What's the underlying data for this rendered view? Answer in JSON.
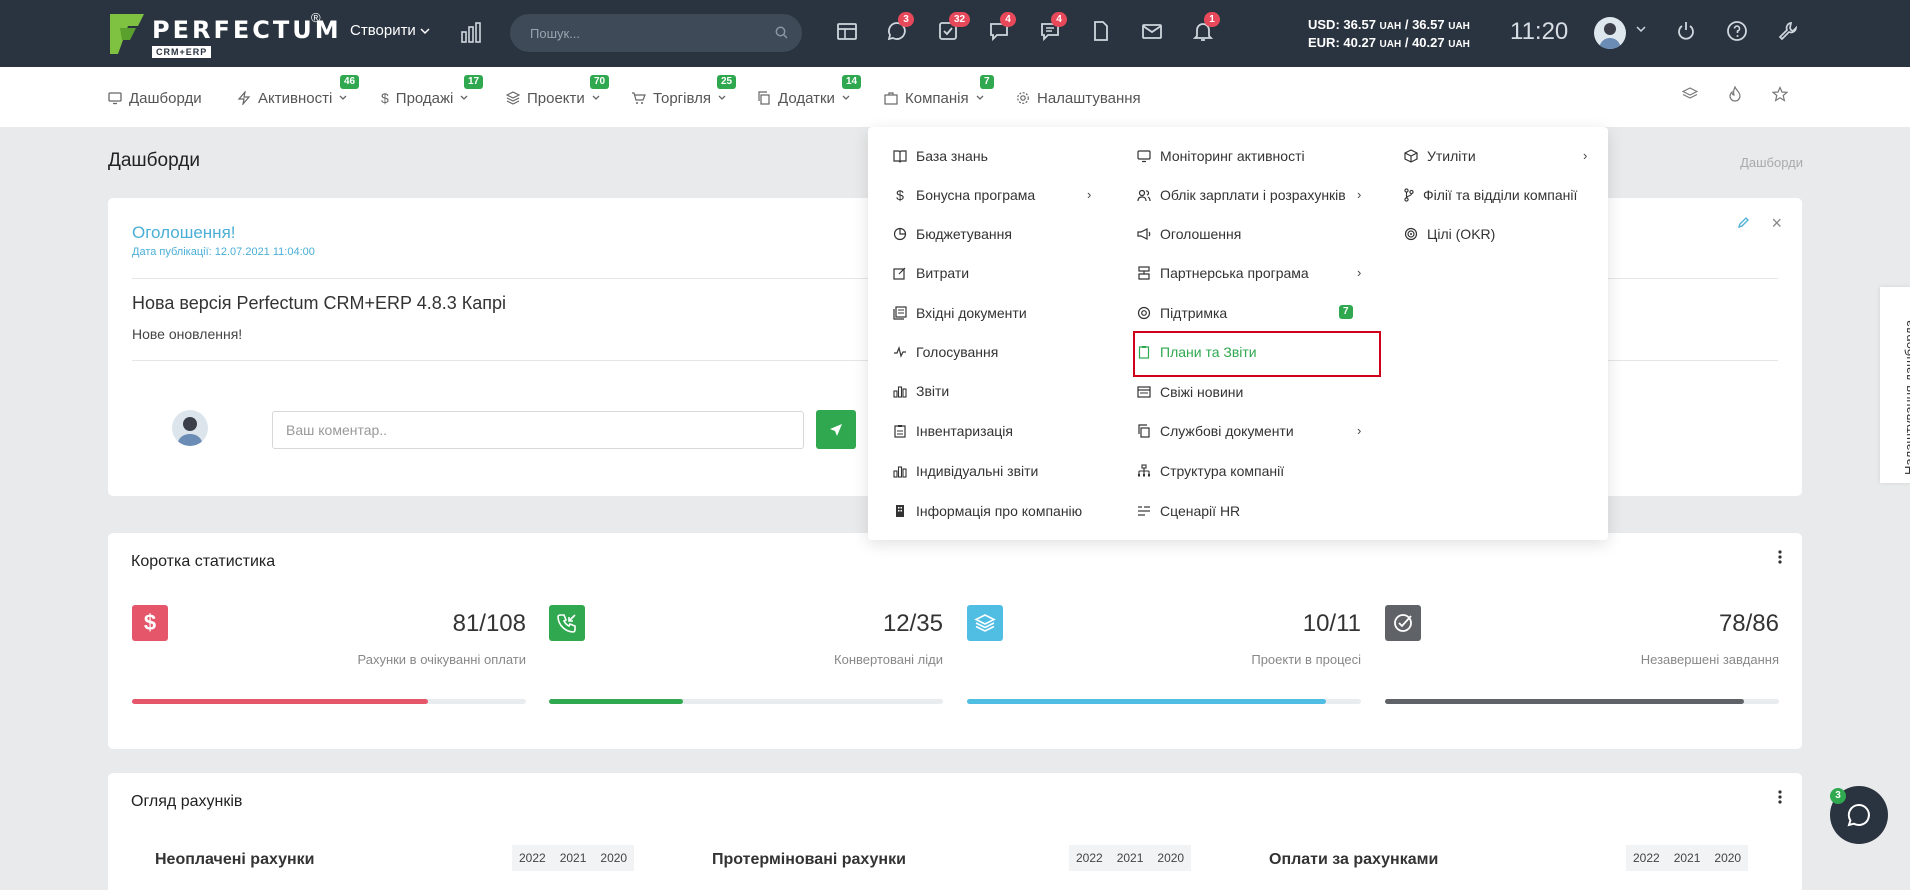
{
  "topbar": {
    "logo_text": "PERFECTUM",
    "logo_sub": "CRM+ERP",
    "logo_reg": "®",
    "create_label": "Створити",
    "search_placeholder": "Пошук...",
    "badges": {
      "chat": "3",
      "tasks": "32",
      "messages": "4",
      "comments": "4",
      "notifications": "1"
    },
    "currency_usd": "USD: 36.57",
    "currency_usd_rate2": "/ 36.57",
    "currency_eur": "EUR: 40.27",
    "currency_eur_rate2": "/ 40.27",
    "currency_unit": "UAH",
    "clock": "11:20"
  },
  "nav": {
    "items": [
      {
        "label": "Дашборди",
        "badge": ""
      },
      {
        "label": "Активності",
        "badge": "46"
      },
      {
        "label": "Продажі",
        "badge": "17"
      },
      {
        "label": "Проекти",
        "badge": "70"
      },
      {
        "label": "Торгівля",
        "badge": "25"
      },
      {
        "label": "Додатки",
        "badge": "14"
      },
      {
        "label": "Компанія",
        "badge": "7"
      },
      {
        "label": "Налаштування",
        "badge": ""
      }
    ]
  },
  "page": {
    "title": "Дашборди",
    "breadcrumb": "Дашборди"
  },
  "announcement": {
    "title": "Оголошення!",
    "date": "Дата публікації: 12.07.2021 11:04:00",
    "heading": "Нова версія Perfectum CRM+ERP 4.8.3 Капрі",
    "body": "Нове оновлення!",
    "comment_placeholder": "Ваш коментар.."
  },
  "stats": {
    "title": "Коротка статистика",
    "items": [
      {
        "value": "81/108",
        "label": "Рахунки в очікуванні оплати",
        "fraction": 0.75,
        "color": "#e5566a"
      },
      {
        "value": "12/35",
        "label": "Конвертовані ліди",
        "fraction": 0.34,
        "color": "#2fa84f"
      },
      {
        "value": "10/11",
        "label": "Проекти в процесі",
        "fraction": 0.91,
        "color": "#50bde3"
      },
      {
        "value": "78/86",
        "label": "Незавершені завдання",
        "fraction": 0.91,
        "color": "#5f6368"
      }
    ]
  },
  "invoices": {
    "title": "Огляд рахунків",
    "sections": [
      {
        "label": "Неоплачені рахунки",
        "years": [
          "2022",
          "2021",
          "2020"
        ]
      },
      {
        "label": "Протерміновані рахунки",
        "years": [
          "2022",
          "2021",
          "2020"
        ]
      },
      {
        "label": "Оплати за рахунками",
        "years": [
          "2022",
          "2021",
          "2020"
        ]
      }
    ]
  },
  "dropdown": {
    "col1": [
      {
        "label": "База знань",
        "icon": "book-icon"
      },
      {
        "label": "Бонусна програма",
        "icon": "dollar-icon",
        "arrow": true
      },
      {
        "label": "Бюджетування",
        "icon": "budget-icon"
      },
      {
        "label": "Витрати",
        "icon": "edit-icon"
      },
      {
        "label": "Вхідні документи",
        "icon": "docs-icon"
      },
      {
        "label": "Голосування",
        "icon": "pulse-icon"
      },
      {
        "label": "Звіти",
        "icon": "bar-chart-icon"
      },
      {
        "label": "Інвентаризація",
        "icon": "clipboard-icon"
      },
      {
        "label": "Індивідуальні звіти",
        "icon": "bar-chart-icon"
      },
      {
        "label": "Інформація про компанію",
        "icon": "building-icon"
      }
    ],
    "col2": [
      {
        "label": "Моніторинг активності",
        "icon": "monitor-icon"
      },
      {
        "label": "Облік зарплати і розрахунків",
        "icon": "users-icon",
        "arrow": true
      },
      {
        "label": "Оголошення",
        "icon": "megaphone-icon"
      },
      {
        "label": "Партнерська програма",
        "icon": "partner-icon",
        "arrow": true
      },
      {
        "label": "Підтримка",
        "icon": "lifebuoy-icon",
        "badge": "7"
      },
      {
        "label": "Плани та Звіти",
        "icon": "clipboard-icon",
        "active": true
      },
      {
        "label": "Свіжі новини",
        "icon": "news-icon"
      },
      {
        "label": "Службові документи",
        "icon": "copy-icon",
        "arrow": true
      },
      {
        "label": "Структура компанії",
        "icon": "hierarchy-icon"
      },
      {
        "label": "Сценарії HR",
        "icon": "list-icon"
      }
    ],
    "col3": [
      {
        "label": "Утиліти",
        "icon": "box-icon",
        "arrow": true
      },
      {
        "label": "Філії та відділи компанії",
        "icon": "branch-icon"
      },
      {
        "label": "Цілі (OKR)",
        "icon": "target-icon"
      }
    ]
  },
  "side": {
    "settings_tab": "Налаштування дашборда",
    "chat_badge": "3"
  },
  "colors": {
    "topbar": "#2a3440",
    "accent_green": "#2fa84f",
    "link_blue": "#4aaed6",
    "badge_red": "#e8495a",
    "highlight_red": "#d0021b"
  }
}
